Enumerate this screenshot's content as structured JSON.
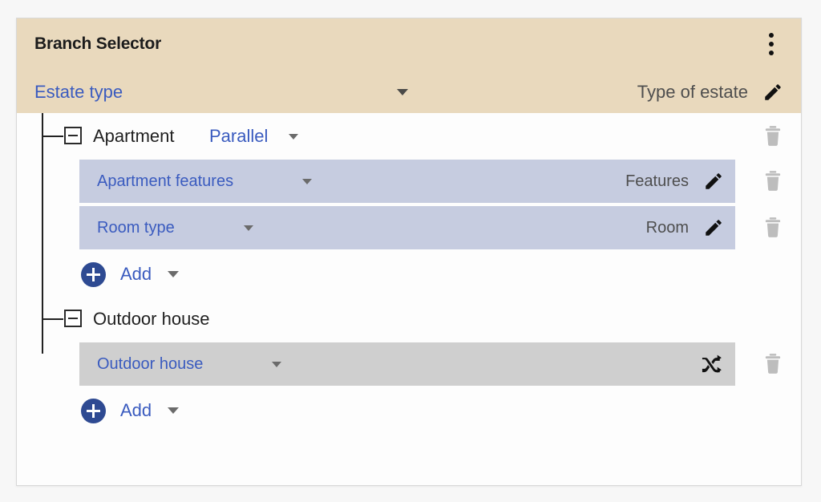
{
  "header": {
    "title": "Branch Selector",
    "menu_icon": "kebab-menu-icon",
    "selector_label": "Estate type",
    "selector_caret": "chevron-down-icon",
    "value_label": "Type of estate",
    "edit_icon": "pencil-icon"
  },
  "tree": {
    "groups": [
      {
        "name": "Apartment",
        "mode": "Parallel",
        "collapse_state": "expanded",
        "delete_icon": "trash-icon",
        "items": [
          {
            "label": "Apartment features",
            "value": "Features",
            "action_icon": "pencil-icon",
            "style": "blue",
            "delete_icon": "trash-icon"
          },
          {
            "label": "Room type",
            "value": "Room",
            "action_icon": "pencil-icon",
            "style": "blue",
            "delete_icon": "trash-icon"
          }
        ],
        "add_label": "Add"
      },
      {
        "name": "Outdoor house",
        "mode": "",
        "collapse_state": "expanded",
        "items": [
          {
            "label": "Outdoor house",
            "value": "",
            "action_icon": "shuffle-icon",
            "style": "gray",
            "delete_icon": "trash-icon"
          }
        ],
        "add_label": "Add"
      }
    ]
  },
  "colors": {
    "header_bg": "#e9d9bd",
    "link_blue": "#3a5bbf",
    "row_blue": "#c6cce0",
    "row_gray": "#cfcfcf",
    "accent_button": "#2e4a92"
  }
}
